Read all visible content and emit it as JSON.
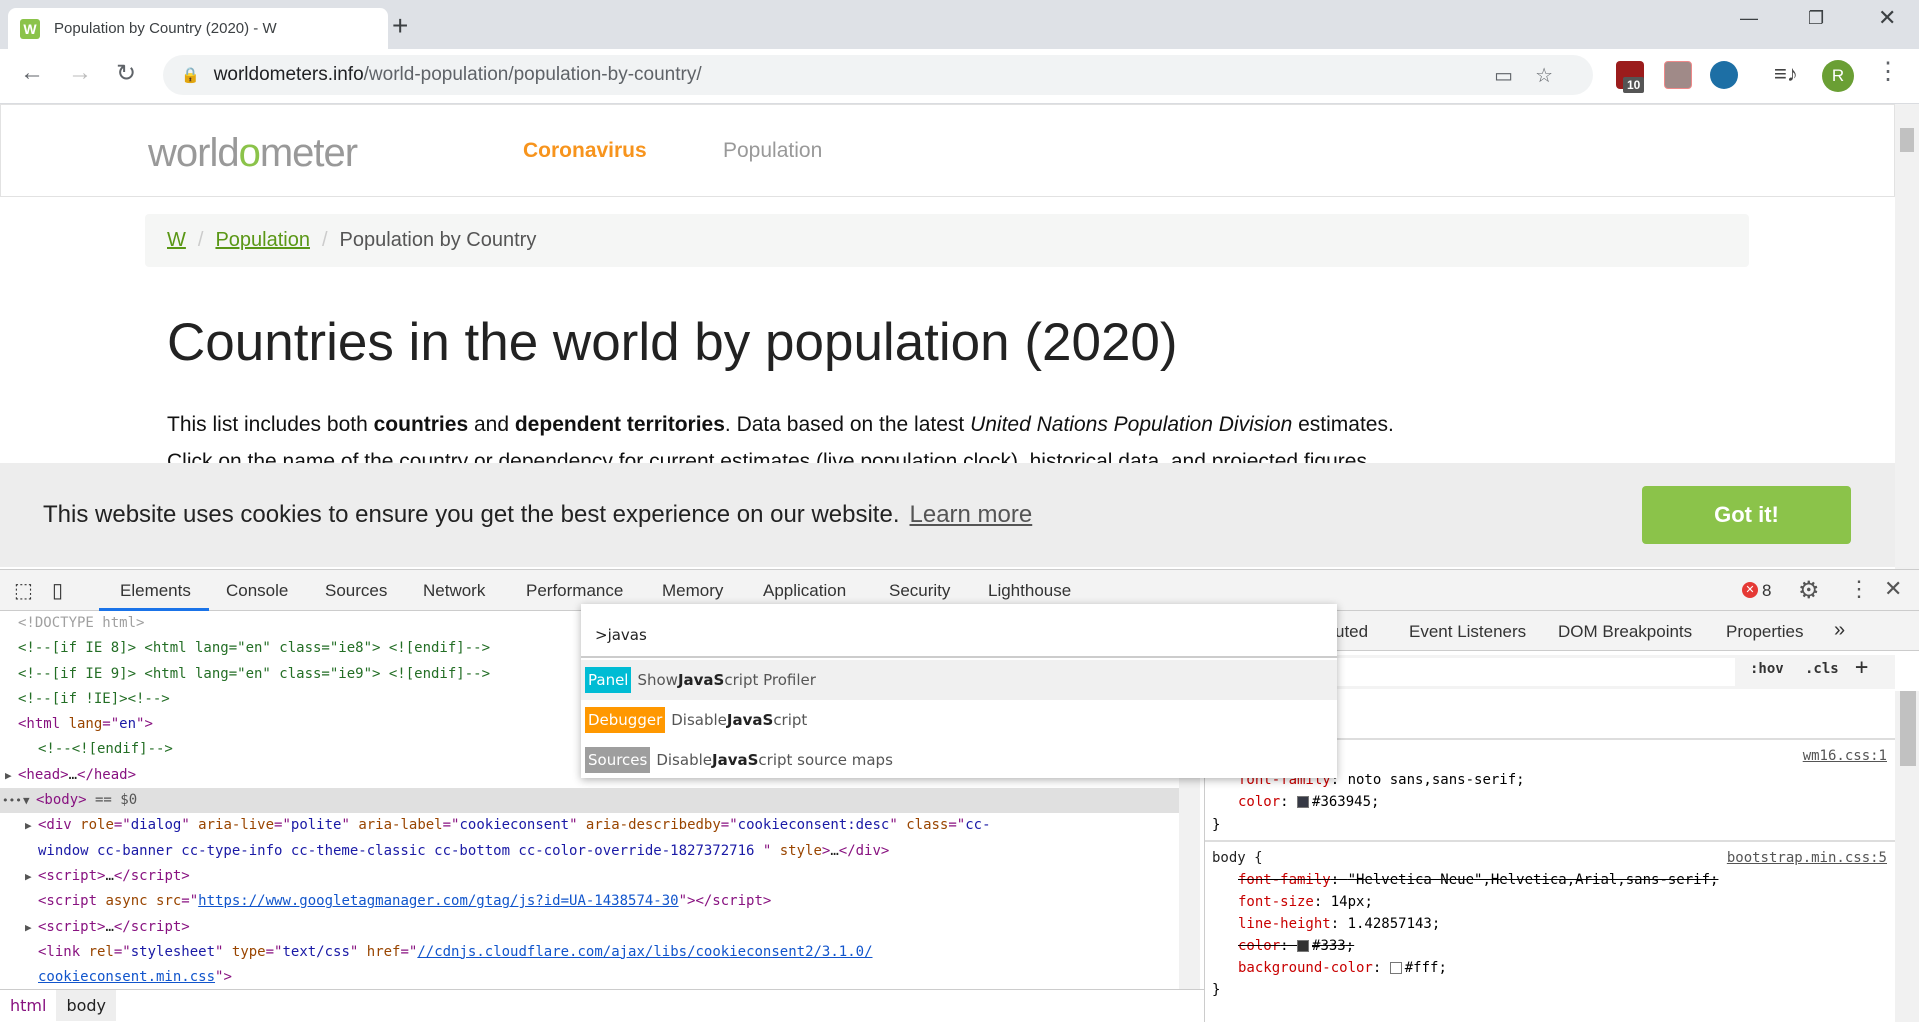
{
  "browser": {
    "tab_title": "Population by Country (2020) - W",
    "favicon_letter": "W",
    "url_host": "worldometers.info",
    "url_path": "/world-population/population-by-country/",
    "extension_badge": "10",
    "avatar_letter": "R"
  },
  "site": {
    "logo_pre": "world",
    "logo_o": "o",
    "logo_post": "meter",
    "nav": [
      "Coronavirus",
      "Population"
    ],
    "breadcrumb": [
      "W",
      "Population",
      "Population by Country"
    ],
    "title": "Countries in the world by population (2020)",
    "para1": [
      "This list includes both ",
      "countries",
      " and ",
      "dependent territories",
      ". Data based on the latest ",
      "United Nations Population Division",
      " estimates."
    ],
    "para2": "Click on the name of the country or dependency for current estimates (live population clock), historical data, and projected figures.",
    "cookie_text": "This website uses cookies to ensure you get the best experience on our website.",
    "cookie_link": "Learn more",
    "cookie_button": "Got it!"
  },
  "devtools": {
    "tabs": [
      "Elements",
      "Console",
      "Sources",
      "Network",
      "Performance",
      "Memory",
      "Application",
      "Security",
      "Lighthouse"
    ],
    "error_count": "8",
    "right_tabs": [
      "uted",
      "Event Listeners",
      "DOM Breakpoints",
      "Properties",
      "»"
    ],
    "hov": ":hov",
    "cls": ".cls",
    "breadcrumb": [
      "html",
      "body"
    ],
    "elements": [
      {
        "i": 0,
        "s": [
          [
            "g",
            "<!DOCTYPE html>"
          ]
        ]
      },
      {
        "i": 0,
        "s": [
          [
            "c",
            "<!--[if IE 8]> <html lang=\"en\" class=\"ie8\"> <![endif]-->"
          ]
        ]
      },
      {
        "i": 0,
        "s": [
          [
            "c",
            "<!--[if IE 9]> <html lang=\"en\" class=\"ie9\"> <![endif]-->"
          ]
        ]
      },
      {
        "i": 0,
        "s": [
          [
            "c",
            "<!--[if !IE]><!-->"
          ]
        ]
      },
      {
        "i": 0,
        "s": [
          [
            "t",
            "<html "
          ],
          [
            "a",
            "lang"
          ],
          [
            "t",
            "=\""
          ],
          [
            "v",
            "en"
          ],
          [
            "t",
            "\">"
          ]
        ]
      },
      {
        "i": 1,
        "s": [
          [
            "c",
            "<!--<![endif]-->"
          ]
        ]
      },
      {
        "i": 0,
        "arrow": "▶",
        "s": [
          [
            "t",
            "<head>"
          ],
          [
            "k",
            "…"
          ],
          [
            "t",
            "</head>"
          ]
        ]
      },
      {
        "i": 0,
        "arrow": "▼",
        "sel": true,
        "s": [
          [
            "t",
            "<body>"
          ],
          [
            "x",
            " == "
          ],
          [
            "x",
            "$0"
          ]
        ]
      },
      {
        "i": 1,
        "arrow": "▶",
        "s": [
          [
            "t",
            "<div "
          ],
          [
            "a",
            "role"
          ],
          [
            "t",
            "=\""
          ],
          [
            "v",
            "dialog"
          ],
          [
            "t",
            "\" "
          ],
          [
            "a",
            "aria-live"
          ],
          [
            "t",
            "=\""
          ],
          [
            "v",
            "polite"
          ],
          [
            "t",
            "\" "
          ],
          [
            "a",
            "aria-label"
          ],
          [
            "t",
            "=\""
          ],
          [
            "v",
            "cookieconsent"
          ],
          [
            "t",
            "\" "
          ],
          [
            "a",
            "aria-describedby"
          ],
          [
            "t",
            "=\""
          ],
          [
            "v",
            "cookieconsent:desc"
          ],
          [
            "t",
            "\" "
          ],
          [
            "a",
            "class"
          ],
          [
            "t",
            "=\""
          ],
          [
            "v",
            "cc-"
          ]
        ]
      },
      {
        "i": 1,
        "s": [
          [
            "v",
            "window cc-banner cc-type-info cc-theme-classic cc-bottom cc-color-override-1827372716 "
          ],
          [
            "t",
            "\" "
          ],
          [
            "a",
            "style"
          ],
          [
            "t",
            ">"
          ],
          [
            "k",
            "…"
          ],
          [
            "t",
            "</div>"
          ]
        ]
      },
      {
        "i": 1,
        "arrow": "▶",
        "s": [
          [
            "t",
            "<script>"
          ],
          [
            "k",
            "…"
          ],
          [
            "t",
            "</script>"
          ]
        ]
      },
      {
        "i": 1,
        "s": [
          [
            "t",
            "<script "
          ],
          [
            "a",
            "async src"
          ],
          [
            "t",
            "=\""
          ],
          [
            "l",
            "https://www.googletagmanager.com/gtag/js?id=UA-1438574-30"
          ],
          [
            "t",
            "\"></script>"
          ]
        ]
      },
      {
        "i": 1,
        "arrow": "▶",
        "s": [
          [
            "t",
            "<script>"
          ],
          [
            "k",
            "…"
          ],
          [
            "t",
            "</script>"
          ]
        ]
      },
      {
        "i": 1,
        "s": [
          [
            "t",
            "<link "
          ],
          [
            "a",
            "rel"
          ],
          [
            "t",
            "=\""
          ],
          [
            "v",
            "stylesheet"
          ],
          [
            "t",
            "\" "
          ],
          [
            "a",
            "type"
          ],
          [
            "t",
            "=\""
          ],
          [
            "v",
            "text/css"
          ],
          [
            "t",
            "\" "
          ],
          [
            "a",
            "href"
          ],
          [
            "t",
            "=\""
          ],
          [
            "l",
            "//cdnjs.cloudflare.com/ajax/libs/cookieconsent2/3.1.0/"
          ]
        ]
      },
      {
        "i": 1,
        "s": [
          [
            "l",
            "cookieconsent.min.css"
          ],
          [
            "t",
            "\">"
          ]
        ]
      }
    ],
    "styles": {
      "brace": "{",
      "wm_src": "wm16.css:1",
      "wm_props": [
        [
          "font-family",
          "noto sans,sans-serif",
          false,
          null
        ],
        [
          "color",
          "#363945",
          false,
          "#363945"
        ]
      ],
      "body_selector": "body {",
      "body_src": "bootstrap.min.css:5",
      "body_props": [
        [
          "font-family",
          "\"Helvetica Neue\",Helvetica,Arial,sans-serif",
          true,
          null
        ],
        [
          "font-size",
          "14px",
          false,
          null
        ],
        [
          "line-height",
          "1.42857143",
          false,
          null
        ],
        [
          "color",
          "#333",
          true,
          "#333"
        ],
        [
          "background-color",
          "#fff",
          false,
          "#fff"
        ]
      ],
      "close": "}"
    },
    "command_menu": {
      "query": ">javas",
      "items": [
        {
          "badge": "Panel",
          "color": "#00bcd4",
          "pre": "Show ",
          "bold": "JavaS",
          "post": "cript Profiler"
        },
        {
          "badge": "Debugger",
          "color": "#ff9800",
          "pre": "Disable ",
          "bold": "JavaS",
          "post": "cript"
        },
        {
          "badge": "Sources",
          "color": "#9e9e9e",
          "pre": "Disable ",
          "bold": "JavaS",
          "post": "cript source maps"
        }
      ]
    }
  }
}
